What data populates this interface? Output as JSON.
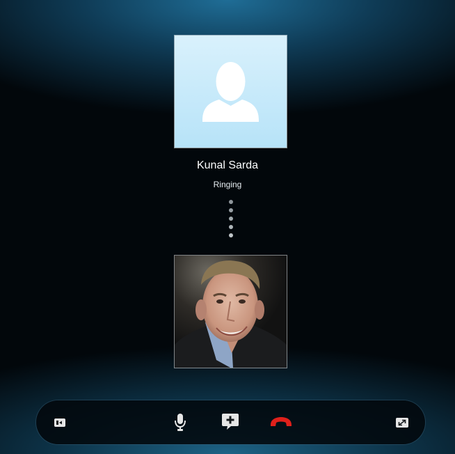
{
  "call": {
    "contact_name": "Kunal Sarda",
    "status": "Ringing",
    "progress_dots": 5
  },
  "icons": {
    "callee_avatar": "default-person-avatar-icon",
    "self_video": "self-video-preview",
    "show_conversation": "show-conversation-icon",
    "mute": "microphone-icon",
    "add_participant": "add-people-chat-bubble-icon",
    "end_call": "hang-up-phone-icon",
    "full_screen": "expand-full-screen-icon"
  },
  "colors": {
    "end_call": "#e0201b",
    "avatar_background": "#c6eafa",
    "controls": "#e6e6e6"
  }
}
